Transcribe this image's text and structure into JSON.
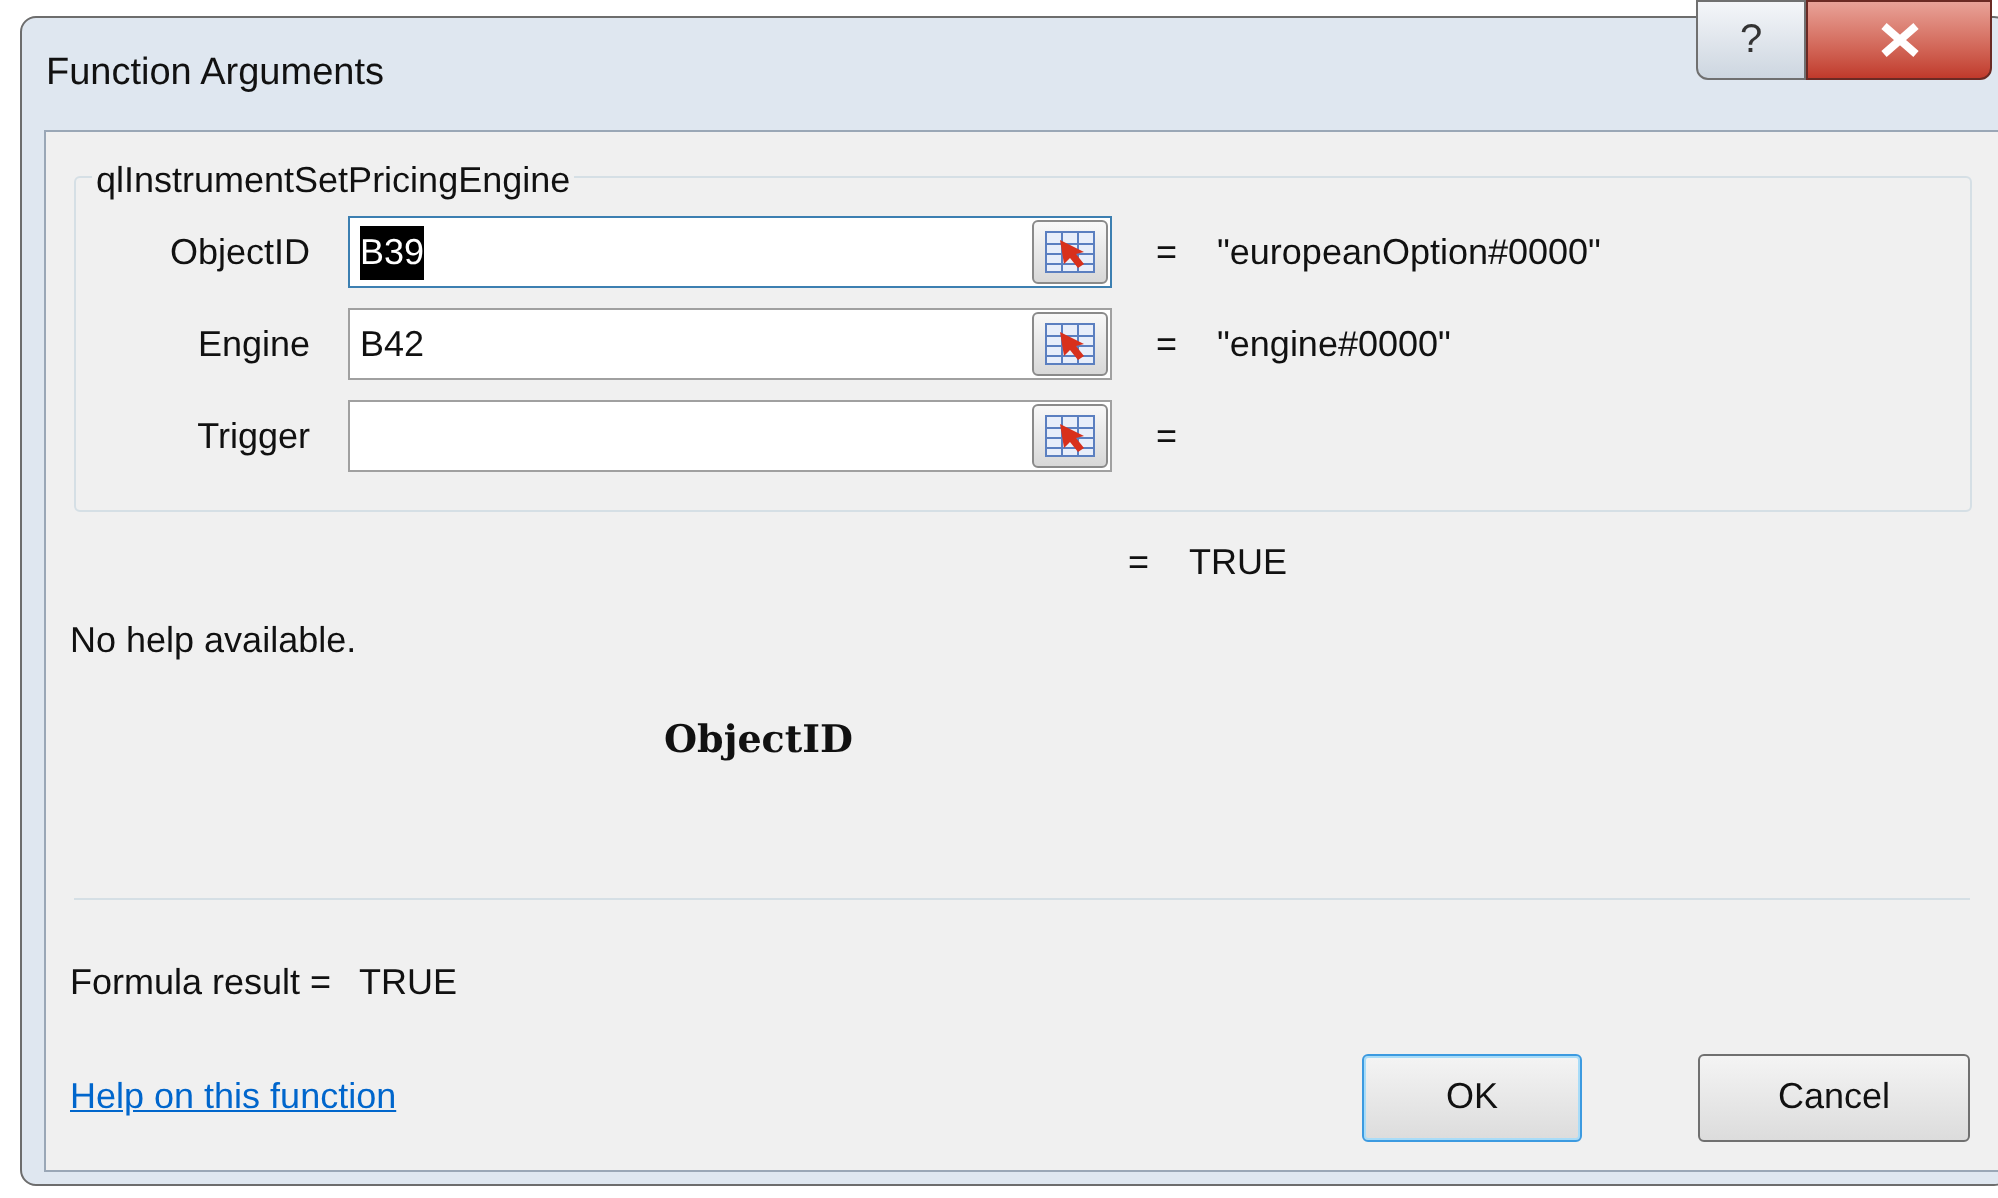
{
  "window": {
    "title": "Function Arguments",
    "help_button": "?"
  },
  "function": {
    "name": "qlInstrumentSetPricingEngine",
    "arguments": [
      {
        "label": "ObjectID",
        "value": "B39",
        "highlighted": true,
        "equals": "=",
        "result": "\"europeanOption#0000\""
      },
      {
        "label": "Engine",
        "value": "B42",
        "highlighted": false,
        "equals": "=",
        "result": "\"engine#0000\""
      },
      {
        "label": "Trigger",
        "highlighted": false,
        "equals": "="
      }
    ],
    "equals": "=",
    "result": "TRUE"
  },
  "description": "No help available.",
  "argument_name": "ObjectID",
  "formula_result": {
    "label": "Formula result =",
    "value": "TRUE"
  },
  "help_link": "Help on this function",
  "buttons": [
    {
      "label": "OK",
      "default": true
    },
    {
      "label": "Cancel",
      "default": false
    }
  ]
}
